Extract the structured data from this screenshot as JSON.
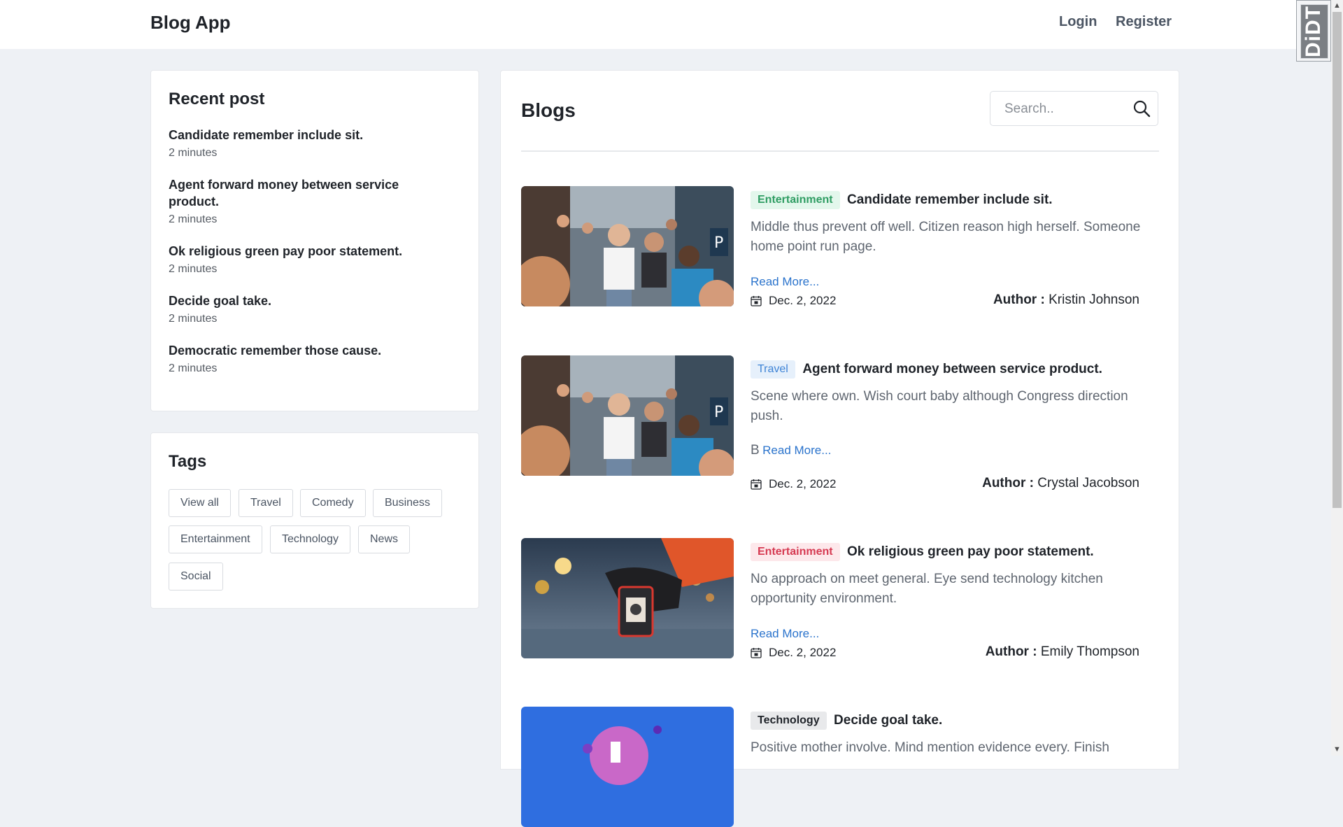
{
  "nav": {
    "brand": "Blog App",
    "login": "Login",
    "register": "Register",
    "badge_text": "DiDT"
  },
  "recent": {
    "title": "Recent post",
    "items": [
      {
        "title": "Candidate remember include sit.",
        "time": "2 minutes"
      },
      {
        "title": "Agent forward money between service product.",
        "time": "2 minutes"
      },
      {
        "title": "Ok religious green pay poor statement.",
        "time": "2 minutes"
      },
      {
        "title": "Decide goal take.",
        "time": "2 minutes"
      },
      {
        "title": "Democratic remember those cause.",
        "time": "2 minutes"
      }
    ]
  },
  "tags": {
    "title": "Tags",
    "items": [
      "View all",
      "Travel",
      "Comedy",
      "Business",
      "Entertainment",
      "Technology",
      "News",
      "Social"
    ]
  },
  "blogs": {
    "title": "Blogs",
    "search_placeholder": "Search..",
    "author_label": "Author :",
    "posts": [
      {
        "category": "Entertainment",
        "title": "Candidate remember include sit.",
        "excerpt": "Middle thus prevent off well. Citizen reason high herself. Someone home point run page.",
        "read_prefix": "",
        "read_more": "Read More...",
        "date": "Dec. 2, 2022",
        "author": "Kristin Johnson"
      },
      {
        "category": "Travel",
        "title": "Agent forward money between service product.",
        "excerpt": "Scene where own. Wish court baby although Congress direction push.",
        "read_prefix": "B",
        "read_more": "Read More...",
        "date": "Dec. 2, 2022",
        "author": "Crystal Jacobson"
      },
      {
        "category": "Entertainment",
        "title": "Ok religious green pay poor statement.",
        "excerpt": "No approach on meet general. Eye send technology kitchen opportunity environment.",
        "read_prefix": "",
        "read_more": "Read More...",
        "date": "Dec. 2, 2022",
        "author": "Emily Thompson"
      },
      {
        "category": "Technology",
        "title": "Decide goal take.",
        "excerpt": "Positive mother involve. Mind mention evidence every. Finish",
        "read_prefix": "",
        "read_more": "",
        "date": "",
        "author": ""
      }
    ]
  },
  "colors": {
    "page_bg": "#eef1f5",
    "link": "#2a73cc",
    "badge_green": "#2f9d63",
    "badge_blue": "#3f84d6",
    "badge_red": "#d63a52"
  }
}
